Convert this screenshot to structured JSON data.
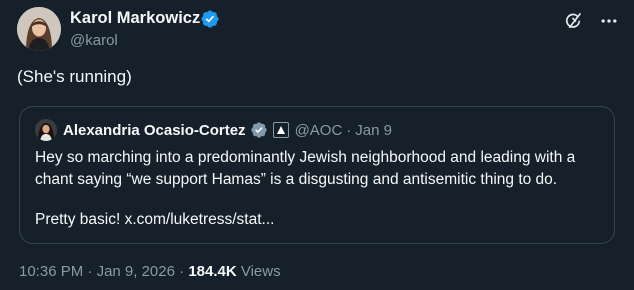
{
  "author": {
    "name": "Karol Markowicz",
    "handle": "@karol",
    "verified_color": "#1d9bf0"
  },
  "tweet": {
    "text": "(She's running)"
  },
  "quote": {
    "author": {
      "name": "Alexandria Ocasio-Cortez",
      "handle": "@AOC",
      "separator": "·",
      "date": "Jan 9",
      "verified_color": "#829aab"
    },
    "lines": [
      "Hey so marching into a predominantly Jewish neighborhood and leading with a",
      "chant saying “we support Hamas” is a disgusting and antisemitic thing to do.",
      "Pretty basic! x.com/luketress/stat..."
    ]
  },
  "meta": {
    "time": "10:36 PM",
    "separator": "·",
    "date": "Jan 9, 2026",
    "views_count": "184.4K",
    "views_label": "Views"
  },
  "icons": {
    "grok": "grok-icon",
    "more": "more-icon",
    "verified": "verified-badge-icon",
    "affiliation": "government-affiliation-icon"
  },
  "colors": {
    "background": "#15202b",
    "text": "#f7f9f9",
    "secondary": "#8b98a5",
    "border": "#38444d"
  }
}
